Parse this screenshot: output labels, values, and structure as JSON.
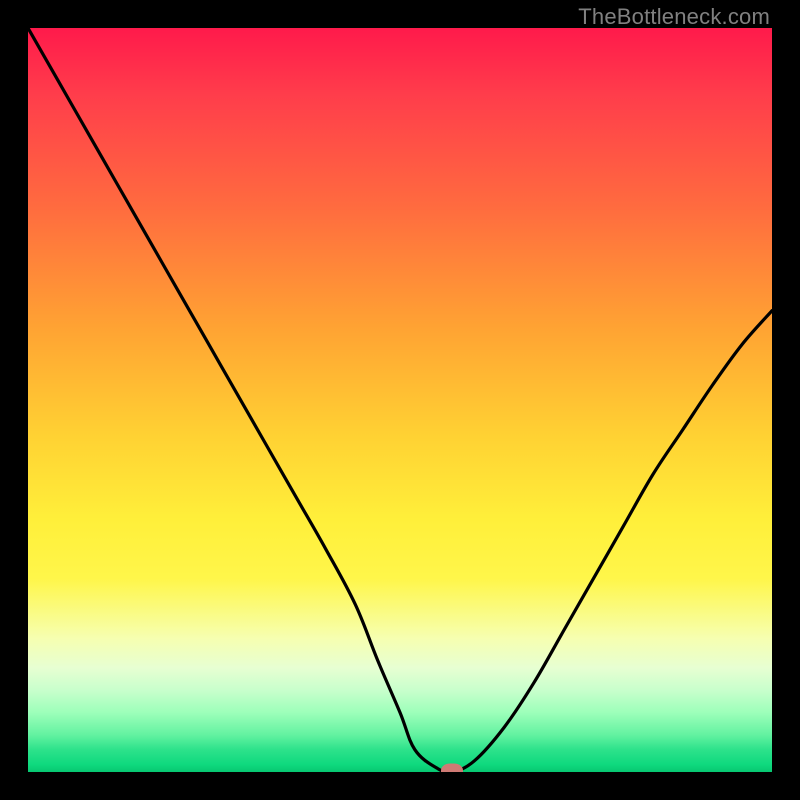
{
  "attribution": "TheBottleneck.com",
  "colors": {
    "frame": "#000000",
    "curve": "#000000",
    "marker": "#cf7a74"
  },
  "chart_data": {
    "type": "line",
    "title": "",
    "xlabel": "",
    "ylabel": "",
    "xlim": [
      0,
      100
    ],
    "ylim": [
      0,
      100
    ],
    "grid": false,
    "legend": false,
    "series": [
      {
        "name": "bottleneck-curve",
        "x": [
          0,
          4,
          8,
          12,
          16,
          20,
          24,
          28,
          32,
          36,
          40,
          44,
          47,
          50,
          52,
          55,
          57,
          60,
          64,
          68,
          72,
          76,
          80,
          84,
          88,
          92,
          96,
          100
        ],
        "y": [
          100,
          93,
          86,
          79,
          72,
          65,
          58,
          51,
          44,
          37,
          30,
          22.5,
          15,
          8,
          3,
          0.5,
          0,
          1.5,
          6,
          12,
          19,
          26,
          33,
          40,
          46,
          52,
          57.5,
          62
        ]
      }
    ],
    "marker": {
      "x": 57,
      "y": 0
    }
  }
}
